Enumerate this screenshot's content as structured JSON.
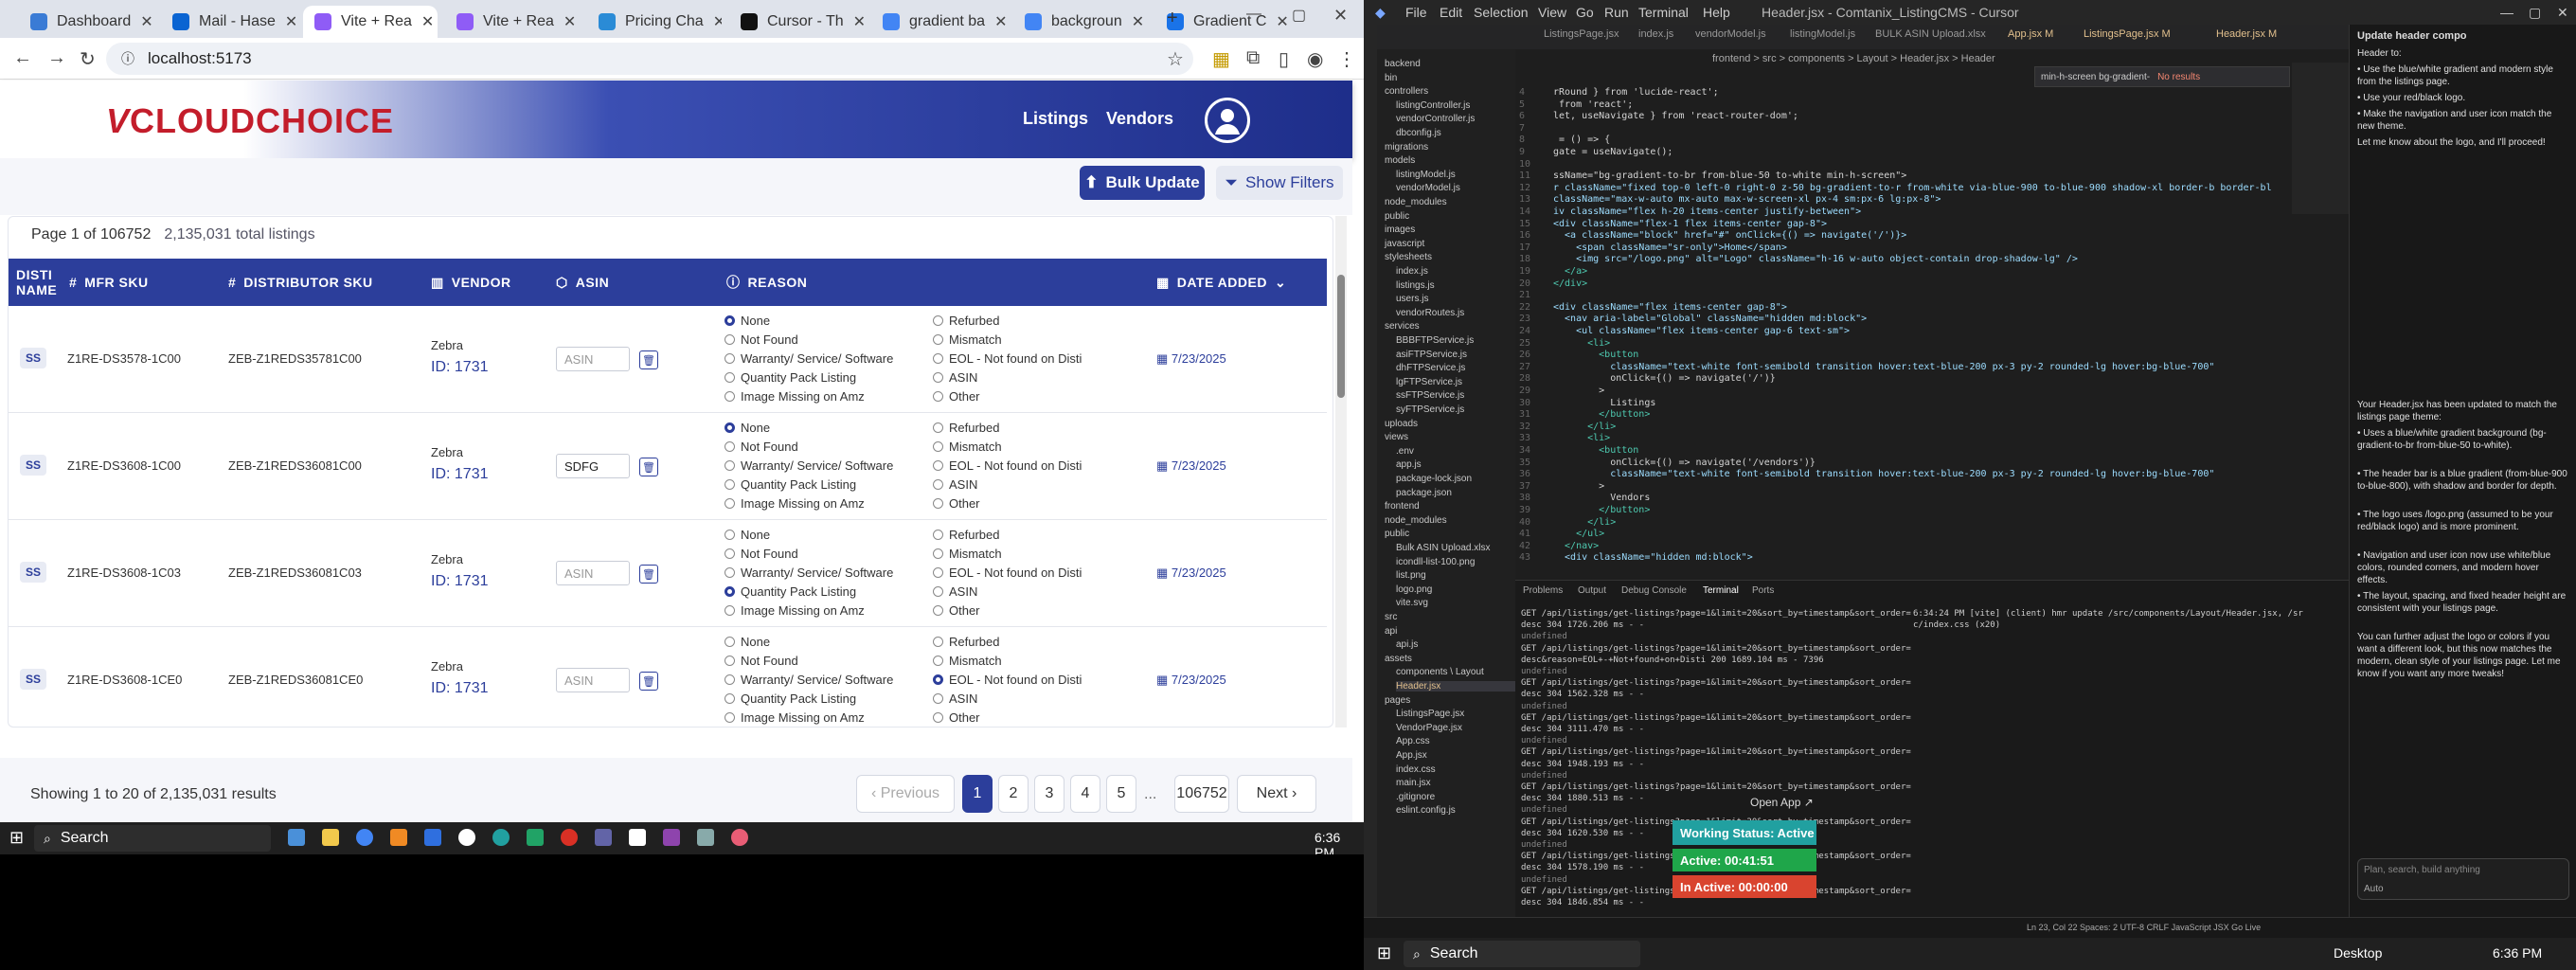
{
  "browser": {
    "tabs": [
      {
        "label": "Dashboard",
        "color": "#3a7bd5"
      },
      {
        "label": "Mail - Hase",
        "color": "#0a64d2"
      },
      {
        "label": "Vite + Rea",
        "color": "#8f5cf6"
      },
      {
        "label": "Vite + Rea",
        "color": "#8f5cf6"
      },
      {
        "label": "Pricing Cha",
        "color": "#2a8bd6"
      },
      {
        "label": "Cursor - Th",
        "color": "#111111"
      },
      {
        "label": "gradient ba",
        "color": "#4285f4"
      },
      {
        "label": "backgroun",
        "color": "#4285f4"
      },
      {
        "label": "Gradient C",
        "color": "#1a73e8"
      }
    ],
    "url": "localhost:5173"
  },
  "app": {
    "logo_v": "V",
    "logo_text": "CLOUDCHOICE",
    "nav": {
      "listings": "Listings",
      "vendors": "Vendors"
    },
    "bulk_update": "Bulk Update",
    "show_filters": "Show Filters",
    "page_info": "Page 1 of 106752",
    "total": "2,135,031 total listings",
    "headers": {
      "disti": "DISTI NAME",
      "mfr": "MFR SKU",
      "dist_sku": "DISTRIBUTOR SKU",
      "vendor": "VENDOR",
      "asin": "ASIN",
      "reason": "REASON",
      "date": "DATE ADDED"
    },
    "reasons_left": [
      "None",
      "Not Found",
      "Warranty/ Service/ Software",
      "Quantity Pack Listing",
      "Image Missing on Amz"
    ],
    "reasons_right": [
      "Refurbed",
      "Mismatch",
      "EOL - Not found on Disti",
      "ASIN",
      "Other"
    ],
    "rows": [
      {
        "disti": "SS",
        "mfr": "Z1RE-DS3578-1C00",
        "dist": "ZEB-Z1REDS35781C00",
        "vendor": "Zebra",
        "vid": "ID: 1731",
        "asin": "",
        "selected": "None",
        "date": "7/23/2025"
      },
      {
        "disti": "SS",
        "mfr": "Z1RE-DS3608-1C00",
        "dist": "ZEB-Z1REDS36081C00",
        "vendor": "Zebra",
        "vid": "ID: 1731",
        "asin": "SDFG",
        "selected": "None",
        "date": "7/23/2025"
      },
      {
        "disti": "SS",
        "mfr": "Z1RE-DS3608-1C03",
        "dist": "ZEB-Z1REDS36081C03",
        "vendor": "Zebra",
        "vid": "ID: 1731",
        "asin": "",
        "selected": "Quantity Pack Listing",
        "date": "7/23/2025"
      },
      {
        "disti": "SS",
        "mfr": "Z1RE-DS3608-1CE0",
        "dist": "ZEB-Z1REDS36081CE0",
        "vendor": "Zebra",
        "vid": "ID: 1731",
        "asin": "",
        "selected": "EOL - Not found on Disti",
        "date": "7/23/2025"
      }
    ],
    "asin_placeholder": "ASIN",
    "showing": "Showing 1 to 20 of 2,135,031 results",
    "pager": {
      "prev": "‹ Previous",
      "pages": [
        "1",
        "2",
        "3",
        "4",
        "5"
      ],
      "ellipsis": "...",
      "last": "106752",
      "next": "Next ›"
    }
  },
  "taskbar": {
    "search": "Search",
    "time": "6:36 PM"
  },
  "cursor": {
    "menus": [
      "File",
      "Edit",
      "Selection",
      "View",
      "Go",
      "Run",
      "Terminal",
      "Help"
    ],
    "title": "Header.jsx - Comtanix_ListingCMS - Cursor",
    "tabs": [
      "ListingsPage.jsx",
      "index.js",
      "vendorModel.js",
      "listingModel.js",
      "BULK ASIN Upload.xlsx",
      "App.jsx M",
      "ListingsPage.jsx M",
      "Header.jsx M"
    ],
    "breadcrumb": "frontend > src > components > Layout > Header.jsx > Header",
    "find": "min-h-screen bg-gradient-",
    "find_result": "No results",
    "explorer": [
      "backend",
      "bin",
      "controllers",
      "listingController.js",
      "vendorController.js",
      "dbconfig.js",
      "migrations",
      "models",
      "listingModel.js",
      "vendorModel.js",
      "node_modules",
      "public",
      "images",
      "javascript",
      "stylesheets",
      "index.js",
      "listings.js",
      "users.js",
      "vendorRoutes.js",
      "services",
      "BBBFTPService.js",
      "asiFTPService.js",
      "dhFTPService.js",
      "lgFTPService.js",
      "ssFTPService.js",
      "syFTPService.js",
      "uploads",
      "views",
      ".env",
      "app.js",
      "package-lock.json",
      "package.json",
      "frontend",
      "node_modules",
      "public",
      "Bulk ASIN Upload.xlsx",
      "icondll-list-100.png",
      "list.png",
      "logo.png",
      "vite.svg",
      "src",
      "api",
      "api.js",
      "assets",
      "components \\ Layout",
      "Header.jsx",
      "pages",
      "ListingsPage.jsx",
      "VendorPage.jsx",
      "App.css",
      "App.jsx",
      "index.css",
      "main.jsx",
      ".gitignore",
      "eslint.config.js"
    ],
    "code": [
      "rRound } from 'lucide-react';",
      " from 'react';",
      "let, useNavigate } from 'react-router-dom';",
      "",
      " = () => {",
      "gate = useNavigate();",
      "",
      "ssName=\"bg-gradient-to-br from-blue-50 to-white min-h-screen\">",
      "r className=\"fixed top-0 left-0 right-0 z-50 bg-gradient-to-r from-white via-blue-900 to-blue-900 shadow-xl border-b border-bl",
      "className=\"max-w-auto mx-auto max-w-screen-xl px-4 sm:px-6 lg:px-8\">",
      "iv className=\"flex h-20 items-center justify-between\">",
      "<div className=\"flex-1 flex items-center gap-8\">",
      "  <a className=\"block\" href=\"#\" onClick={() => navigate('/')}>",
      "    <span className=\"sr-only\">Home</span>",
      "    <img src=\"/logo.png\" alt=\"Logo\" className=\"h-16 w-auto object-contain drop-shadow-lg\" />",
      "  </a>",
      "</div>",
      "",
      "<div className=\"flex items-center gap-8\">",
      "  <nav aria-label=\"Global\" className=\"hidden md:block\">",
      "    <ul className=\"flex items-center gap-6 text-sm\">",
      "      <li>",
      "        <button",
      "          className=\"text-white font-semibold transition hover:text-blue-200 px-3 py-2 rounded-lg hover:bg-blue-700\"",
      "          onClick={() => navigate('/')}",
      "        >",
      "          Listings",
      "        </button>",
      "      </li>",
      "      <li>",
      "        <button",
      "          onClick={() => navigate('/vendors')}",
      "          className=\"text-white font-semibold transition hover:text-blue-200 px-3 py-2 rounded-lg hover:bg-blue-700\"",
      "        >",
      "          Vendors",
      "        </button>",
      "      </li>",
      "    </ul>",
      "  </nav>",
      "  <div className=\"hidden md:block\">"
    ],
    "terminal_tabs": [
      "Problems",
      "Output",
      "Debug Console",
      "Terminal",
      "Ports"
    ],
    "terminal": [
      "GET /api/listings/get-listings?page=1&limit=20&sort_by=timestamp&sort_order=",
      "desc 304 1726.206 ms - -",
      "undefined",
      "GET /api/listings/get-listings?page=1&limit=20&sort_by=timestamp&sort_order=",
      "desc&reason=EOL+-+Not+found+on+Disti 200 1689.104 ms - 7396",
      "undefined",
      "GET /api/listings/get-listings?page=1&limit=20&sort_by=timestamp&sort_order=",
      "desc 304 1562.328 ms - -",
      "undefined",
      "GET /api/listings/get-listings?page=1&limit=20&sort_by=timestamp&sort_order=",
      "desc 304 3111.470 ms - -",
      "undefined",
      "GET /api/listings/get-listings?page=1&limit=20&sort_by=timestamp&sort_order=",
      "desc 304 1948.193 ms - -",
      "undefined",
      "GET /api/listings/get-listings?page=1&limit=20&sort_by=timestamp&sort_order=",
      "desc 304 1880.513 ms - -",
      "undefined",
      "GET /api/listings/get-listings?page=1&limit=20&sort_by=timestamp&sort_order=",
      "desc 304 1620.530 ms - -",
      "undefined",
      "GET /api/listings/get-listings?page=1&limit=20&sort_by=timestamp&sort_order=",
      "desc 304 1578.190 ms - -",
      "undefined",
      "GET /api/listings/get-listings?page=1&limit=20&sort_by=timestamp&sort_order=",
      "desc 304 1846.854 ms - -"
    ],
    "vite_log": "6:34:24 PM [vite] (client) hmr update /src/components/Layout/Header.jsx, /sr",
    "vite_log2": "c/index.css (x20)",
    "chat_title": "Update header compo",
    "chat": [
      "Header to:",
      "• Use the blue/white gradient and modern style from the listings page.",
      "• Use your red/black logo.",
      "• Make the navigation and user icon match the new theme.",
      "Let me know about the logo, and I'll proceed!",
      "",
      "Your Header.jsx has been updated to match the listings page theme:",
      "• Uses a blue/white gradient background (bg-gradient-to-br from-blue-50 to-white).",
      "• The header bar is a blue gradient (from-blue-900 to-blue-800), with shadow and border for depth.",
      "• The logo uses /logo.png (assumed to be your red/black logo) and is more prominent.",
      "• Navigation and user icon now use white/blue colors, rounded corners, and modern hover effects.",
      "• The layout, spacing, and fixed header height are consistent with your listings page.",
      "You can further adjust the logo or colors if you want a different look, but this now matches the modern, clean style of your listings page. Let me know if you want any more tweaks!"
    ],
    "chat_input": "Plan, search, build anything",
    "chat_mode": "Auto",
    "status": "Ln 23, Col 22   Spaces: 2   UTF-8   CRLF   JavaScript JSX   Go Live",
    "open_app": "Open App ↗",
    "working_status": "Working Status: Active",
    "active": "Active: 00:41:51",
    "inactive": "In Active: 00:00:00"
  },
  "taskbar2": {
    "search": "Search",
    "desktop": "Desktop",
    "time": "6:36 PM"
  }
}
